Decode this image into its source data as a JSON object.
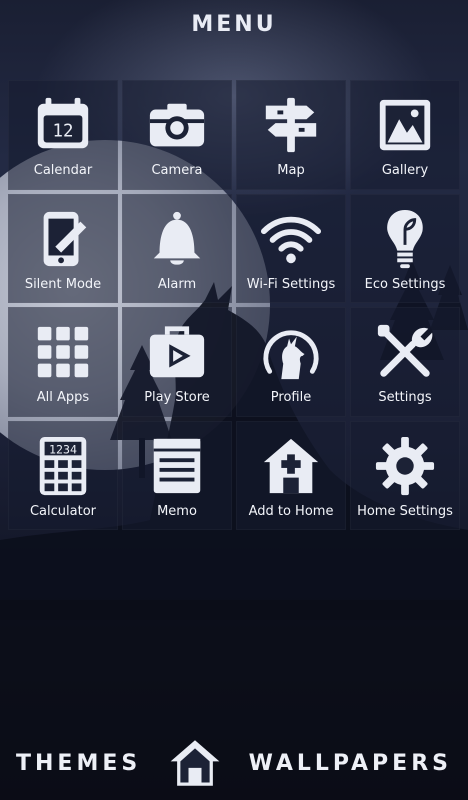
{
  "header": {
    "title": "MENU"
  },
  "grid": {
    "items": [
      {
        "label": "Calendar",
        "icon": "calendar-icon",
        "calendar_day": "12"
      },
      {
        "label": "Camera",
        "icon": "camera-icon"
      },
      {
        "label": "Map",
        "icon": "signpost-icon"
      },
      {
        "label": "Gallery",
        "icon": "gallery-icon"
      },
      {
        "label": "Silent Mode",
        "icon": "silent-phone-icon"
      },
      {
        "label": "Alarm",
        "icon": "bell-icon"
      },
      {
        "label": "Wi-Fi Settings",
        "icon": "wifi-icon"
      },
      {
        "label": "Eco Settings",
        "icon": "lightbulb-icon"
      },
      {
        "label": "All Apps",
        "icon": "apps-grid-icon"
      },
      {
        "label": "Play Store",
        "icon": "play-store-bag-icon"
      },
      {
        "label": "Profile",
        "icon": "wolf-profile-icon"
      },
      {
        "label": "Settings",
        "icon": "tools-icon"
      },
      {
        "label": "Calculator",
        "icon": "calculator-icon",
        "calculator_display": "1234"
      },
      {
        "label": "Memo",
        "icon": "memo-icon"
      },
      {
        "label": "Add to Home",
        "icon": "add-home-icon"
      },
      {
        "label": "Home Settings",
        "icon": "gear-icon"
      }
    ]
  },
  "bottom_bar": {
    "themes_label": "THEMES",
    "wallpapers_label": "WALLPAPERS",
    "home_icon": "home-icon"
  },
  "colors": {
    "icon_fill": "#e9ecf4",
    "icon_dark": "#1c2236",
    "background_top": "#1a1f33",
    "background_bottom": "#0b0d17"
  }
}
